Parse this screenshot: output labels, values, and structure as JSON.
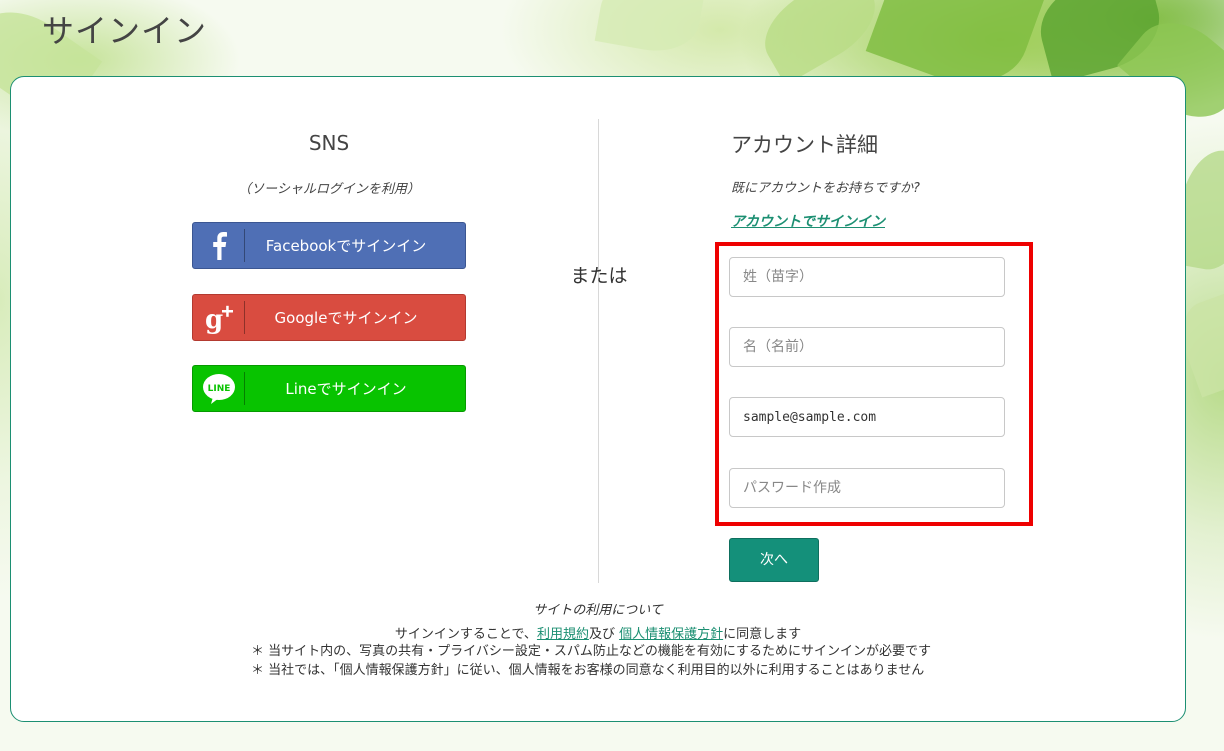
{
  "page": {
    "title": "サインイン"
  },
  "sns": {
    "title": "SNS",
    "subtitle": "（ソーシャルログインを利用）",
    "buttons": [
      {
        "label": "Facebookでサインイン",
        "icon": "facebook-icon",
        "color": "#4f6fb5"
      },
      {
        "label": "Googleでサインイン",
        "icon": "google-plus-icon",
        "color": "#d94c40"
      },
      {
        "label": "Lineでサインイン",
        "icon": "line-icon",
        "color": "#08c300"
      }
    ]
  },
  "or_label": "または",
  "account": {
    "title": "アカウント詳細",
    "question": "既にアカウントをお持ちですか?",
    "signin_link": "アカウントでサインイン",
    "fields": {
      "last_name": {
        "placeholder": "姓（苗字）",
        "value": ""
      },
      "first_name": {
        "placeholder": "名（名前）",
        "value": ""
      },
      "email": {
        "placeholder": "",
        "value": "sample@sample.com"
      },
      "password": {
        "placeholder": "パスワード作成",
        "value": ""
      }
    },
    "next_button": "次へ"
  },
  "footer": {
    "title": "サイトの利用について",
    "agree_prefix": "サインインすることで、",
    "terms_link": "利用規約",
    "and": "及び",
    "privacy_link": "個人情報保護方針",
    "agree_suffix": "に同意します",
    "notes": [
      "＊ 当サイト内の、写真の共有・プライバシー設定・スパム防止などの機能を有効にするためにサインインが必要です",
      "＊ 当社では、「個人情報保護方針」に従い、個人情報をお客様の同意なく利用目的以外に利用することはありません"
    ]
  },
  "colors": {
    "accent": "#1c8f72",
    "highlight_border": "#ee0000"
  }
}
